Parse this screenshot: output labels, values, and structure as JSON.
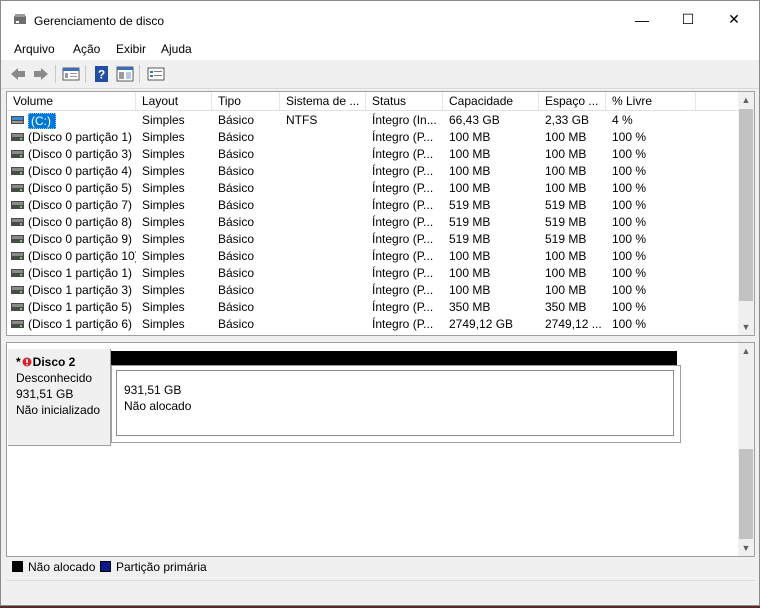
{
  "window": {
    "title": "Gerenciamento de disco",
    "buttons": {
      "minimize": "—",
      "maximize": "☐",
      "close": "✕"
    }
  },
  "menu": [
    "Arquivo",
    "Ação",
    "Exibir",
    "Ajuda"
  ],
  "toolbar": [
    "arrow-left-icon",
    "arrow-right-icon",
    "console-tree-icon",
    "help-icon",
    "properties-icon",
    "settings-icon"
  ],
  "columns": [
    "Volume",
    "Layout",
    "Tipo",
    "Sistema de ...",
    "Status",
    "Capacidade",
    "Espaço ...",
    "% Livre"
  ],
  "rows": [
    {
      "volume": "(C:)",
      "layout": "Simples",
      "tipo": "Básico",
      "fs": "NTFS",
      "status": "Íntegro (In...",
      "cap": "66,43 GB",
      "free": "2,33 GB",
      "pct": "4 %"
    },
    {
      "volume": "(Disco 0 partição 1)",
      "layout": "Simples",
      "tipo": "Básico",
      "fs": "",
      "status": "Íntegro (P...",
      "cap": "100 MB",
      "free": "100 MB",
      "pct": "100 %"
    },
    {
      "volume": "(Disco 0 partição 3)",
      "layout": "Simples",
      "tipo": "Básico",
      "fs": "",
      "status": "Íntegro (P...",
      "cap": "100 MB",
      "free": "100 MB",
      "pct": "100 %"
    },
    {
      "volume": "(Disco 0 partição 4)",
      "layout": "Simples",
      "tipo": "Básico",
      "fs": "",
      "status": "Íntegro (P...",
      "cap": "100 MB",
      "free": "100 MB",
      "pct": "100 %"
    },
    {
      "volume": "(Disco 0 partição 5)",
      "layout": "Simples",
      "tipo": "Básico",
      "fs": "",
      "status": "Íntegro (P...",
      "cap": "100 MB",
      "free": "100 MB",
      "pct": "100 %"
    },
    {
      "volume": "(Disco 0 partição 7)",
      "layout": "Simples",
      "tipo": "Básico",
      "fs": "",
      "status": "Íntegro (P...",
      "cap": "519 MB",
      "free": "519 MB",
      "pct": "100 %"
    },
    {
      "volume": "(Disco 0 partição 8)",
      "layout": "Simples",
      "tipo": "Básico",
      "fs": "",
      "status": "Íntegro (P...",
      "cap": "519 MB",
      "free": "519 MB",
      "pct": "100 %"
    },
    {
      "volume": "(Disco 0 partição 9)",
      "layout": "Simples",
      "tipo": "Básico",
      "fs": "",
      "status": "Íntegro (P...",
      "cap": "519 MB",
      "free": "519 MB",
      "pct": "100 %"
    },
    {
      "volume": "(Disco 0 partição 10)",
      "layout": "Simples",
      "tipo": "Básico",
      "fs": "",
      "status": "Íntegro (P...",
      "cap": "100 MB",
      "free": "100 MB",
      "pct": "100 %"
    },
    {
      "volume": "(Disco 1 partição 1)",
      "layout": "Simples",
      "tipo": "Básico",
      "fs": "",
      "status": "Íntegro (P...",
      "cap": "100 MB",
      "free": "100 MB",
      "pct": "100 %"
    },
    {
      "volume": "(Disco 1 partição 3)",
      "layout": "Simples",
      "tipo": "Básico",
      "fs": "",
      "status": "Íntegro (P...",
      "cap": "100 MB",
      "free": "100 MB",
      "pct": "100 %"
    },
    {
      "volume": "(Disco 1 partição 5)",
      "layout": "Simples",
      "tipo": "Básico",
      "fs": "",
      "status": "Íntegro (P...",
      "cap": "350 MB",
      "free": "350 MB",
      "pct": "100 %"
    },
    {
      "volume": "(Disco 1 partição 6)",
      "layout": "Simples",
      "tipo": "Básico",
      "fs": "",
      "status": "Íntegro (P...",
      "cap": "2749,12 GB",
      "free": "2749,12 ...",
      "pct": "100 %"
    }
  ],
  "disk": {
    "marker": "*",
    "name": "Disco 2",
    "type": "Desconhecido",
    "size": "931,51 GB",
    "state": "Não inicializado",
    "partition_size": "931,51 GB",
    "partition_label": "Não alocado"
  },
  "legend": [
    {
      "label": "Não alocado",
      "color": "#000000"
    },
    {
      "label": "Partição primária",
      "color": "#0a1a8c"
    }
  ],
  "colors": {
    "selection": "#0078d7",
    "disk_error": "#d8212a"
  }
}
